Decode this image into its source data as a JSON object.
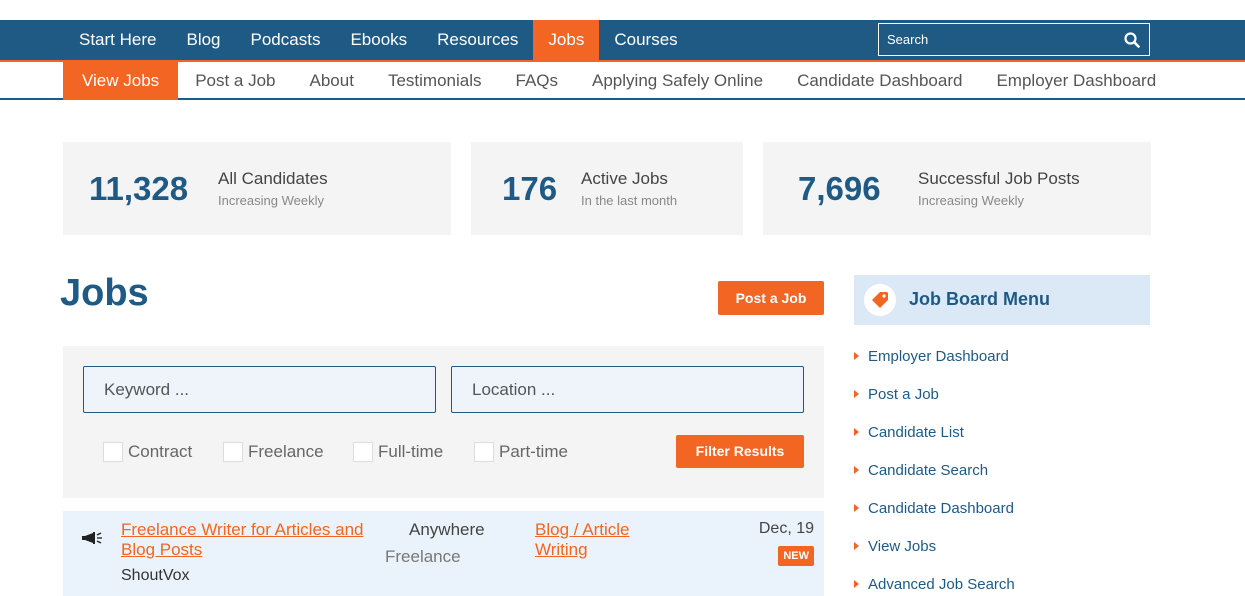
{
  "topnav": {
    "items": [
      {
        "label": "Start Here",
        "active": false
      },
      {
        "label": "Blog",
        "active": false
      },
      {
        "label": "Podcasts",
        "active": false
      },
      {
        "label": "Ebooks",
        "active": false
      },
      {
        "label": "Resources",
        "active": false
      },
      {
        "label": "Jobs",
        "active": true
      },
      {
        "label": "Courses",
        "active": false
      }
    ],
    "search_placeholder": "Search",
    "search_icon": "search-icon"
  },
  "subnav": {
    "items": [
      {
        "label": "View Jobs",
        "active": true
      },
      {
        "label": "Post a Job",
        "active": false
      },
      {
        "label": "About",
        "active": false
      },
      {
        "label": "Testimonials",
        "active": false
      },
      {
        "label": "FAQs",
        "active": false
      },
      {
        "label": "Applying Safely Online",
        "active": false
      },
      {
        "label": "Candidate Dashboard",
        "active": false
      },
      {
        "label": "Employer Dashboard",
        "active": false
      }
    ]
  },
  "stats": [
    {
      "number": "11,328",
      "label": "All Candidates",
      "sub": "Increasing Weekly"
    },
    {
      "number": "176",
      "label": "Active Jobs",
      "sub": "In the last month"
    },
    {
      "number": "7,696",
      "label": "Successful Job Posts",
      "sub": "Increasing Weekly"
    }
  ],
  "jobs": {
    "title": "Jobs",
    "post_button": "Post a Job"
  },
  "filter": {
    "keyword_placeholder": "Keyword ...",
    "location_placeholder": "Location ...",
    "checkboxes": [
      "Contract",
      "Freelance",
      "Full-time",
      "Part-time"
    ],
    "button": "Filter Results"
  },
  "listing": [
    {
      "icon": "megaphone-icon",
      "title": "Freelance Writer for Articles and Blog Posts",
      "company": "ShoutVox",
      "location": "Anywhere",
      "type": "Freelance",
      "category": "Blog / Article Writing",
      "date": "Dec, 19",
      "badge": "NEW"
    }
  ],
  "sidebar": {
    "icon": "tag-icon",
    "title": "Job Board Menu",
    "items": [
      "Employer Dashboard",
      "Post a Job",
      "Candidate List",
      "Candidate Search",
      "Candidate Dashboard",
      "View Jobs",
      "Advanced Job Search"
    ]
  },
  "colors": {
    "primary": "#1f5a85",
    "accent": "#f26522",
    "panel": "#f4f4f4",
    "listing_bg": "#eaf3fb",
    "sidebar_header_bg": "#dbe9f7"
  }
}
